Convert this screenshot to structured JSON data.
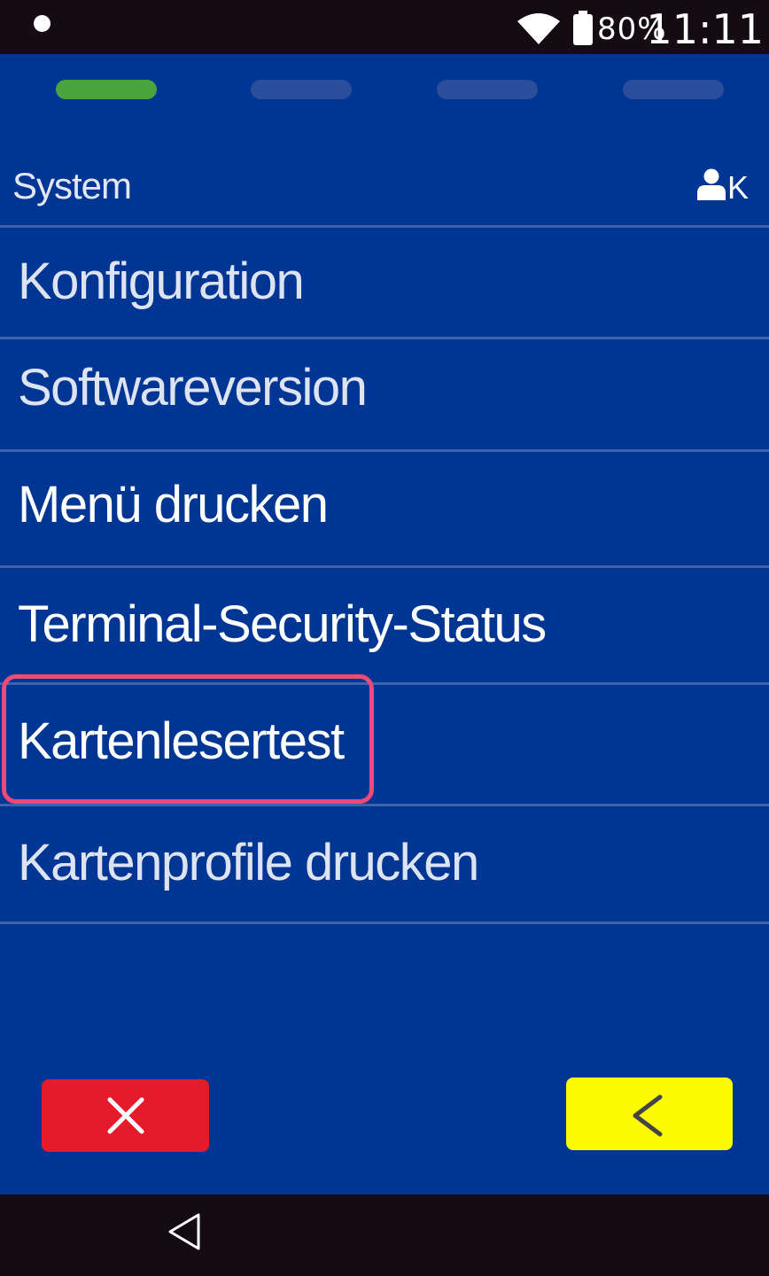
{
  "status_bar": {
    "battery_percent": "80%",
    "time": "11:11",
    "icons": [
      "notification-dot-icon",
      "wifi-icon",
      "battery-icon"
    ]
  },
  "progress": {
    "total_steps": 4,
    "active_step": 1
  },
  "header": {
    "title": "System",
    "user_icon": "user-icon",
    "user_level": "K"
  },
  "menu": {
    "items": [
      {
        "label": "Konfiguration"
      },
      {
        "label": "Softwareversion"
      },
      {
        "label": "Menü drucken"
      },
      {
        "label": "Terminal-Security-Status"
      },
      {
        "label": "Kartenlesertest",
        "highlighted": true
      },
      {
        "label": "Kartenprofile drucken"
      }
    ]
  },
  "buttons": {
    "cancel_icon": "close-icon",
    "back_icon": "chevron-left-icon"
  },
  "colors": {
    "background": "#003693",
    "step_active": "#4aa43d",
    "step_inactive": "#2b4e9c",
    "cancel": "#e51a2b",
    "back": "#fcfb00",
    "highlight": "#ec4a78"
  }
}
